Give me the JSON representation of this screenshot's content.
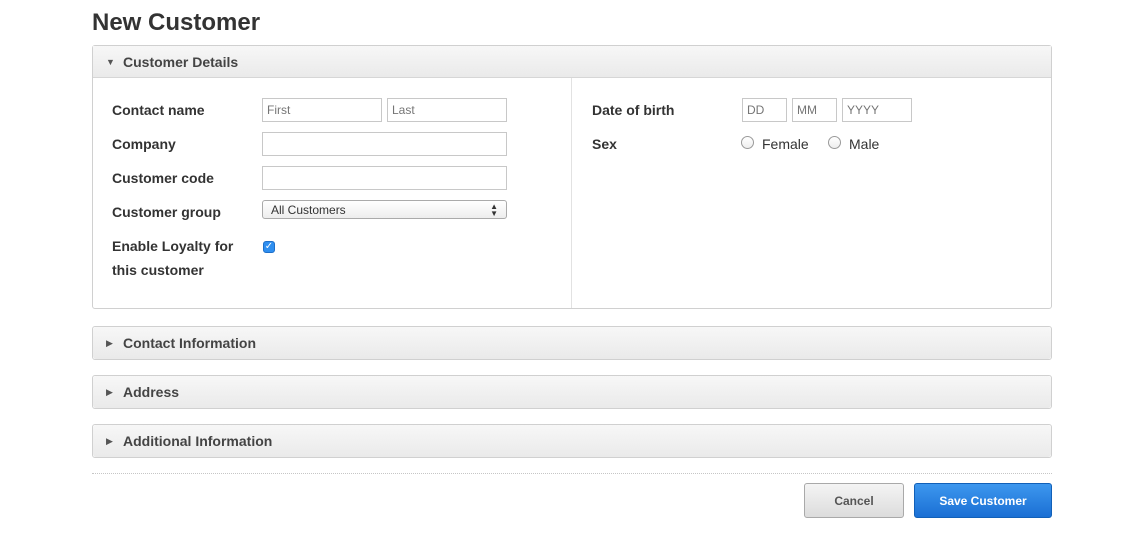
{
  "page": {
    "title": "New Customer"
  },
  "sections": {
    "customer_details": {
      "title": "Customer Details",
      "expanded": true
    },
    "contact_information": {
      "title": "Contact Information",
      "expanded": false
    },
    "address": {
      "title": "Address",
      "expanded": false
    },
    "additional_information": {
      "title": "Additional Information",
      "expanded": false
    }
  },
  "form": {
    "contact_name": {
      "label": "Contact name",
      "first_placeholder": "First",
      "last_placeholder": "Last",
      "first_value": "",
      "last_value": ""
    },
    "company": {
      "label": "Company",
      "value": ""
    },
    "customer_code": {
      "label": "Customer code",
      "value": ""
    },
    "customer_group": {
      "label": "Customer group",
      "selected": "All Customers"
    },
    "loyalty": {
      "label_line1": "Enable Loyalty for",
      "label_line2": "this customer",
      "checked": true
    },
    "date_of_birth": {
      "label": "Date of birth",
      "day_placeholder": "DD",
      "month_placeholder": "MM",
      "year_placeholder": "YYYY"
    },
    "sex": {
      "label": "Sex",
      "options": [
        "Female",
        "Male"
      ],
      "selected": null
    }
  },
  "actions": {
    "cancel": "Cancel",
    "save": "Save Customer"
  },
  "colors": {
    "primary": "#2a82e4",
    "panel_header": "#eeeeee",
    "border": "#d0d0d0"
  },
  "icons": {
    "expanded": "caret-down-icon",
    "collapsed": "caret-right-icon",
    "checkbox": "checkmark-icon"
  }
}
